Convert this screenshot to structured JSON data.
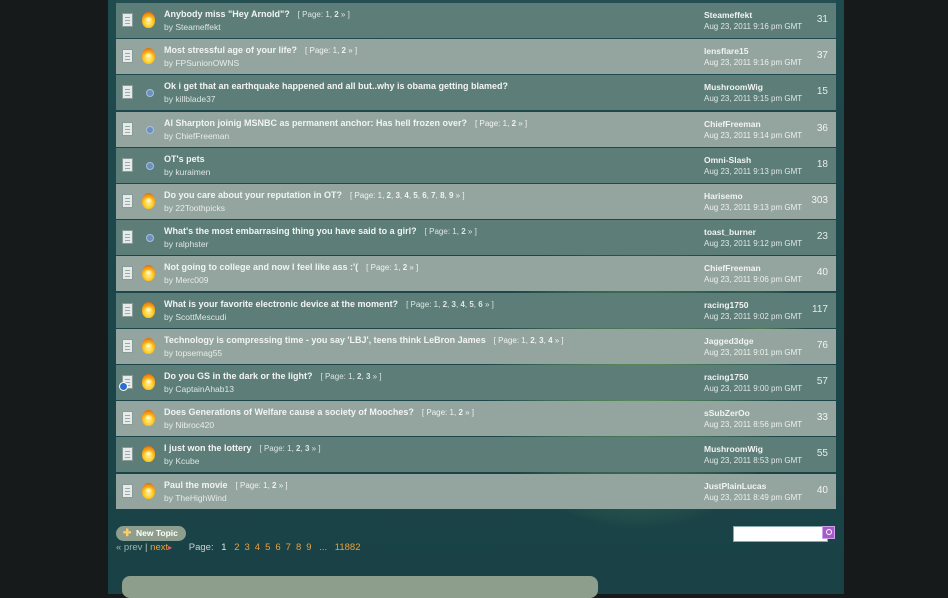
{
  "topics": [
    {
      "title": "Anybody miss \"Hey Arnold\"?",
      "pages": [
        "1",
        "2"
      ],
      "author": "Steameffekt",
      "last_by": "Steameffekt",
      "last_date": "Aug 23, 2011 9:16 pm GMT",
      "count": "31",
      "icon": "flame"
    },
    {
      "title": "Most stressful age of your life?",
      "pages": [
        "1",
        "2"
      ],
      "author": "FPSunionOWNS",
      "last_by": "lensflare15",
      "last_date": "Aug 23, 2011 9:16 pm GMT",
      "count": "37",
      "icon": "flame"
    },
    {
      "title": "Ok i get that an earthquake happened and all but..why is obama getting blamed?",
      "pages": [],
      "author": "killblade37",
      "last_by": "MushroomWig",
      "last_date": "Aug 23, 2011 9:15 pm GMT",
      "count": "15",
      "icon": "dot"
    },
    {
      "title": "Al Sharpton joinig MSNBC as permanent anchor: Has hell frozen over?",
      "pages": [
        "1",
        "2"
      ],
      "author": "ChiefFreeman",
      "last_by": "ChiefFreeman",
      "last_date": "Aug 23, 2011 9:14 pm GMT",
      "count": "36",
      "icon": "dot"
    },
    {
      "title": "OT's pets",
      "pages": [],
      "author": "kuraimen",
      "last_by": "Omni-Slash",
      "last_date": "Aug 23, 2011 9:13 pm GMT",
      "count": "18",
      "icon": "dot"
    },
    {
      "title": "Do you care about your reputation in OT?",
      "pages": [
        "1",
        "2",
        "3",
        "4",
        "5",
        "6",
        "7",
        "8",
        "9"
      ],
      "author": "22Toothpicks",
      "last_by": "Harisemo",
      "last_date": "Aug 23, 2011 9:13 pm GMT",
      "count": "303",
      "icon": "flame"
    },
    {
      "title": "What's the most embarrasing thing you have said to a girl?",
      "pages": [
        "1",
        "2"
      ],
      "author": "ralphster",
      "last_by": "toast_burner",
      "last_date": "Aug 23, 2011 9:12 pm GMT",
      "count": "23",
      "icon": "dot"
    },
    {
      "title": "Not going to college and now I feel like ass :'(",
      "pages": [
        "1",
        "2"
      ],
      "author": "Merc009",
      "last_by": "ChiefFreeman",
      "last_date": "Aug 23, 2011 9:06 pm GMT",
      "count": "40",
      "icon": "flame"
    },
    {
      "title": "What is your favorite electronic device at the moment?",
      "pages": [
        "1",
        "2",
        "3",
        "4",
        "5",
        "6"
      ],
      "author": "ScottMescudi",
      "last_by": "racing1750",
      "last_date": "Aug 23, 2011 9:02 pm GMT",
      "count": "117",
      "icon": "flame"
    },
    {
      "title": "Technology is compressing time - you say 'LBJ', teens think LeBron James",
      "pages": [
        "1",
        "2",
        "3",
        "4"
      ],
      "author": "topsemag55",
      "last_by": "Jagged3dge",
      "last_date": "Aug 23, 2011 9:01 pm GMT",
      "count": "76",
      "icon": "flame"
    },
    {
      "title": "Do you GS in the dark or the light?",
      "pages": [
        "1",
        "2",
        "3"
      ],
      "author": "CaptainAhab13",
      "last_by": "racing1750",
      "last_date": "Aug 23, 2011 9:00 pm GMT",
      "count": "57",
      "icon": "flame",
      "bubble": true
    },
    {
      "title": "Does Generations of Welfare cause a society of Mooches?",
      "pages": [
        "1",
        "2"
      ],
      "author": "Nibroc420",
      "last_by": "sSubZerOo",
      "last_date": "Aug 23, 2011 8:56 pm GMT",
      "count": "33",
      "icon": "flame"
    },
    {
      "title": "I just won the lottery",
      "pages": [
        "1",
        "2",
        "3"
      ],
      "author": "Kcube",
      "last_by": "MushroomWig",
      "last_date": "Aug 23, 2011 8:53 pm GMT",
      "count": "55",
      "icon": "flame"
    },
    {
      "title": "Paul the movie",
      "pages": [
        "1",
        "2"
      ],
      "author": "TheHighWind",
      "last_by": "JustPlainLucas",
      "last_date": "Aug 23, 2011 8:49 pm GMT",
      "count": "40",
      "icon": "flame"
    }
  ],
  "labels": {
    "page_prefix": "[ Page:",
    "page_suffix": "» ]",
    "by_prefix": "by",
    "new_topic": "New Topic",
    "prev": "« prev",
    "separator": "|",
    "next": "next",
    "page_label": "Page:"
  },
  "pager": {
    "current": "1",
    "pages": [
      "2",
      "3",
      "4",
      "5",
      "6",
      "7",
      "8",
      "9"
    ],
    "ellipsis": "...",
    "last": "11882"
  },
  "search": {
    "value": ""
  }
}
